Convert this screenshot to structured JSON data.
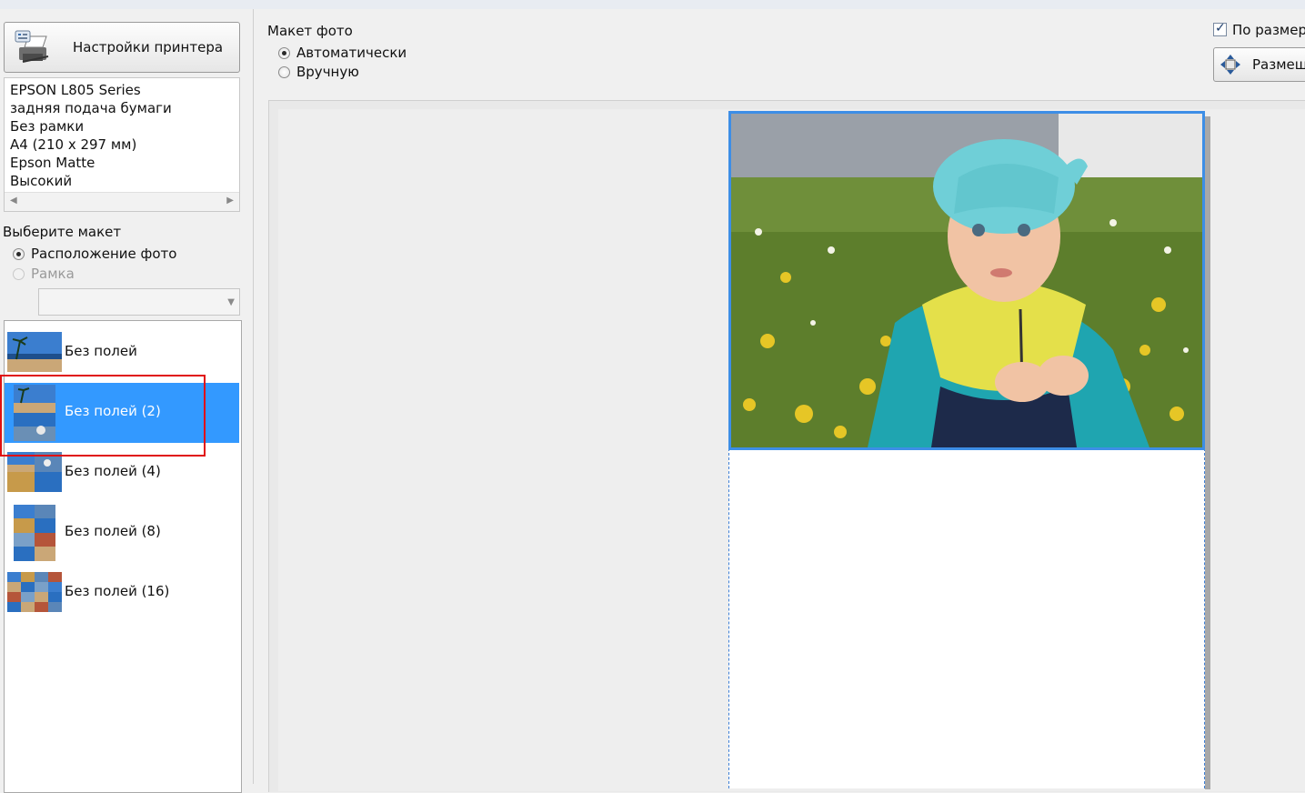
{
  "left_panel": {
    "printer_settings_button": "Настройки принтера",
    "printer_info": [
      "EPSON L805 Series",
      "задняя подача бумаги",
      "Без рамки",
      "A4 (210 x 297 мм)",
      "Epson Matte",
      "Высокий"
    ],
    "choose_layout_label": "Выберите макет",
    "layout_mode_options": [
      {
        "label": "Расположение фото",
        "selected": true,
        "enabled": true
      },
      {
        "label": "Рамка",
        "selected": false,
        "enabled": false
      }
    ],
    "frame_dropdown_value": "",
    "layouts": [
      {
        "label": "Без полей",
        "selected": false
      },
      {
        "label": "Без полей (2)",
        "selected": true
      },
      {
        "label": "Без полей (4)",
        "selected": false
      },
      {
        "label": "Без полей (8)",
        "selected": false
      },
      {
        "label": "Без полей (16)",
        "selected": false
      }
    ]
  },
  "right_panel": {
    "photo_layout_label": "Макет фото",
    "photo_layout_options": [
      {
        "label": "Автоматически",
        "selected": true
      },
      {
        "label": "Вручную",
        "selected": false
      }
    ],
    "fit_checkbox_label": "По размер",
    "fit_checkbox_checked": true,
    "place_button_label": "Размещ"
  },
  "colors": {
    "selection": "#3399ff",
    "highlight_box": "#e01010",
    "photo_border": "#3d8ee6"
  }
}
